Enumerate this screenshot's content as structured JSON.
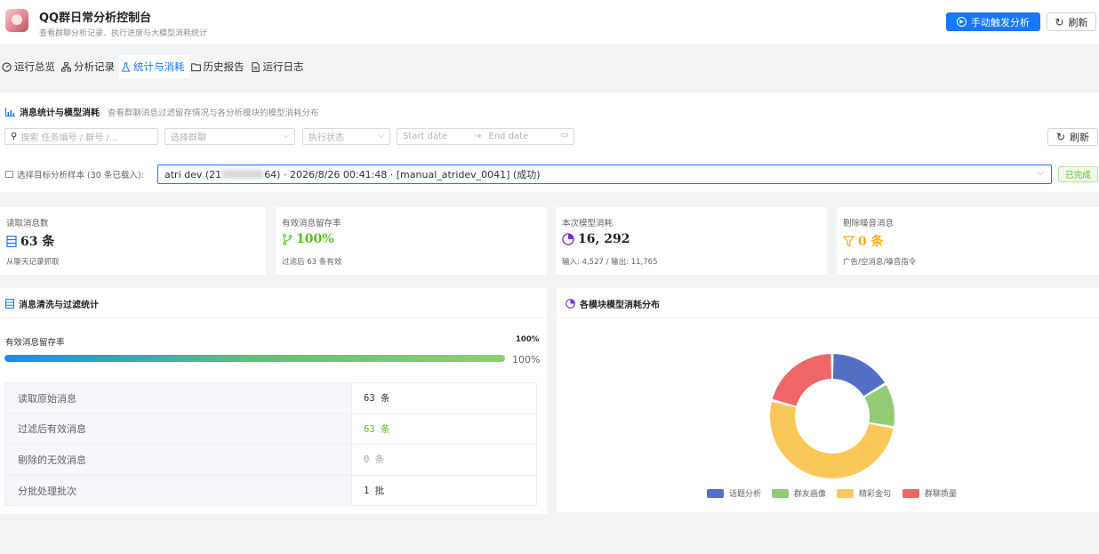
{
  "app": {
    "title": "QQ群日常分析控制台",
    "subtitle": "查看群聊分析记录、执行进度与大模型消耗统计",
    "trigger_label": "手动触发分析",
    "refresh_label": "刷新"
  },
  "tabs": [
    {
      "label": "运行总览",
      "icon": "dashboard-icon"
    },
    {
      "label": "分析记录",
      "icon": "sitemap-icon"
    },
    {
      "label": "统计与消耗",
      "icon": "flask-icon",
      "active": true
    },
    {
      "label": "历史报告",
      "icon": "folder-icon"
    },
    {
      "label": "运行日志",
      "icon": "document-icon"
    }
  ],
  "filter": {
    "title": "消息统计与模型消耗",
    "description": "查看群聊消息过滤留存情况与各分析模块的模型消耗分布",
    "search_placeholder": "搜索 任务编号 / 群号 /...",
    "group_placeholder": "选择群聊",
    "status_placeholder": "执行状态",
    "start_date": "Start date",
    "end_date": "End date",
    "date_arrow": "→",
    "refresh_label": "刷新",
    "sample_label": "选择目标分析样本 (30 条已载入):",
    "sample_prefix": "atri dev (21",
    "sample_suffix": "64) · 2026/8/26 00:41:48 · [manual_atridev_0041] (成功)",
    "status_tag": "已完成"
  },
  "metrics": [
    {
      "label": "读取消息数",
      "value": "63 条",
      "note": "从聊天记录抓取",
      "color": "#1677ff",
      "icon": "list-icon"
    },
    {
      "label": "有效消息留存率",
      "value": "100%",
      "note": "过滤后 63 条有效",
      "color": "#52c41a",
      "icon": "branch-icon"
    },
    {
      "label": "本次模型消耗",
      "value": "16, 292",
      "note": "输入: 4,527 / 输出: 11,765",
      "color": "#722ed1",
      "icon": "pie-icon"
    },
    {
      "label": "剔除噪音消息",
      "value": "0 条",
      "note": "广告/空消息/噪音指令",
      "color": "#faad14",
      "icon": "filter-icon"
    }
  ],
  "cleaning": {
    "title": "消息清洗与过滤统计",
    "ratio_label": "有效消息留存率",
    "ratio_value": "100%",
    "progress": 1.0,
    "progress_text": "100%",
    "rows": [
      {
        "label": "读取原始消息",
        "value": "63 条",
        "color": "#303133"
      },
      {
        "label": "过滤后有效消息",
        "value": "63 条",
        "color": "#52c41a"
      },
      {
        "label": "剔除的无效消息",
        "value": "0 条",
        "color": "#a0a4ab"
      },
      {
        "label": "分批处理批次",
        "value": "1 批",
        "color": "#303133"
      }
    ]
  },
  "chart_data": {
    "type": "pie",
    "title": "各模块模型消耗分布",
    "donut": true,
    "categories": [
      "话题分析",
      "群友画像",
      "精彩金句",
      "群聊质量"
    ],
    "values": [
      14,
      10,
      44,
      18
    ],
    "colors": [
      "#5470c6",
      "#91cc75",
      "#fac858",
      "#ee6666"
    ],
    "legend": "bottom"
  }
}
